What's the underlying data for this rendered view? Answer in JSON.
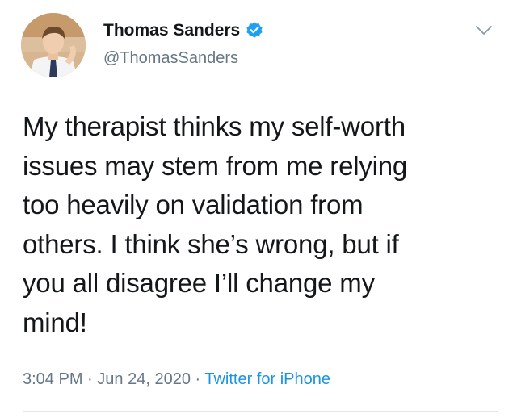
{
  "tweet": {
    "author": {
      "name": "Thomas Sanders",
      "handle": "@ThomasSanders",
      "verified_icon": "verified-badge-icon"
    },
    "text_lines": [
      "My therapist thinks my self-worth",
      "issues may stem from me relying",
      "too heavily on validation from",
      "others. I think she’s wrong, but if",
      "you all disagree I’ll change my",
      "mind!"
    ],
    "time": "3:04 PM",
    "date": "Jun 24, 2020",
    "separator": "·",
    "source": "Twitter for iPhone",
    "menu_icon": "chevron-down-icon"
  },
  "colors": {
    "text": "#14171a",
    "secondary": "#657786",
    "link": "#1b95e0",
    "verified": "#1da1f2"
  }
}
